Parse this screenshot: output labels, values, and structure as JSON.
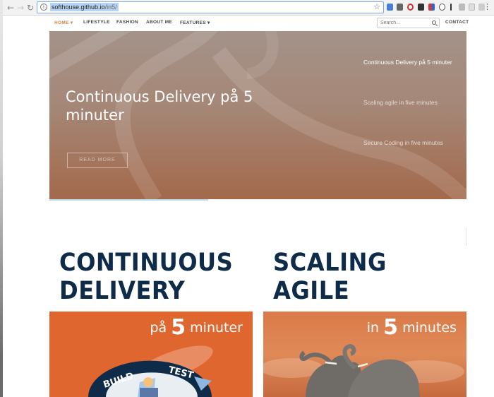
{
  "browser": {
    "url_host": "softhouse.github.io",
    "url_path": "/in5/"
  },
  "nav": {
    "items": [
      {
        "label": "HOME"
      },
      {
        "label": "LIFESTYLE"
      },
      {
        "label": "FASHION"
      },
      {
        "label": "ABOUT ME"
      },
      {
        "label": "FEATURES"
      }
    ],
    "search_placeholder": "Search...",
    "contact": "CONTACT",
    "accent_color": "#c9864f"
  },
  "hero": {
    "title": "Continuous Delivery på 5 minuter",
    "button": "READ MORE",
    "progress": 0.38,
    "slides": [
      {
        "label": "Continuous Delivery på 5 minuter"
      },
      {
        "label": "Scaling agile in five minutes"
      },
      {
        "label": "Secure Coding in five minutes"
      }
    ]
  },
  "cards": [
    {
      "title_line1": "CONTINUOUS",
      "title_line2": "DELIVERY",
      "banner_pre": "på",
      "banner_num": "5",
      "banner_post": "minuter",
      "banner_color": "#e0662f"
    },
    {
      "title_line1": "SCALING",
      "title_line2": "AGILE",
      "banner_pre": "in",
      "banner_num": "5",
      "banner_post": "minutes",
      "banner_color": "#d9794a"
    }
  ],
  "logo_text": {
    "build": "BUILD",
    "test": "TEST"
  }
}
